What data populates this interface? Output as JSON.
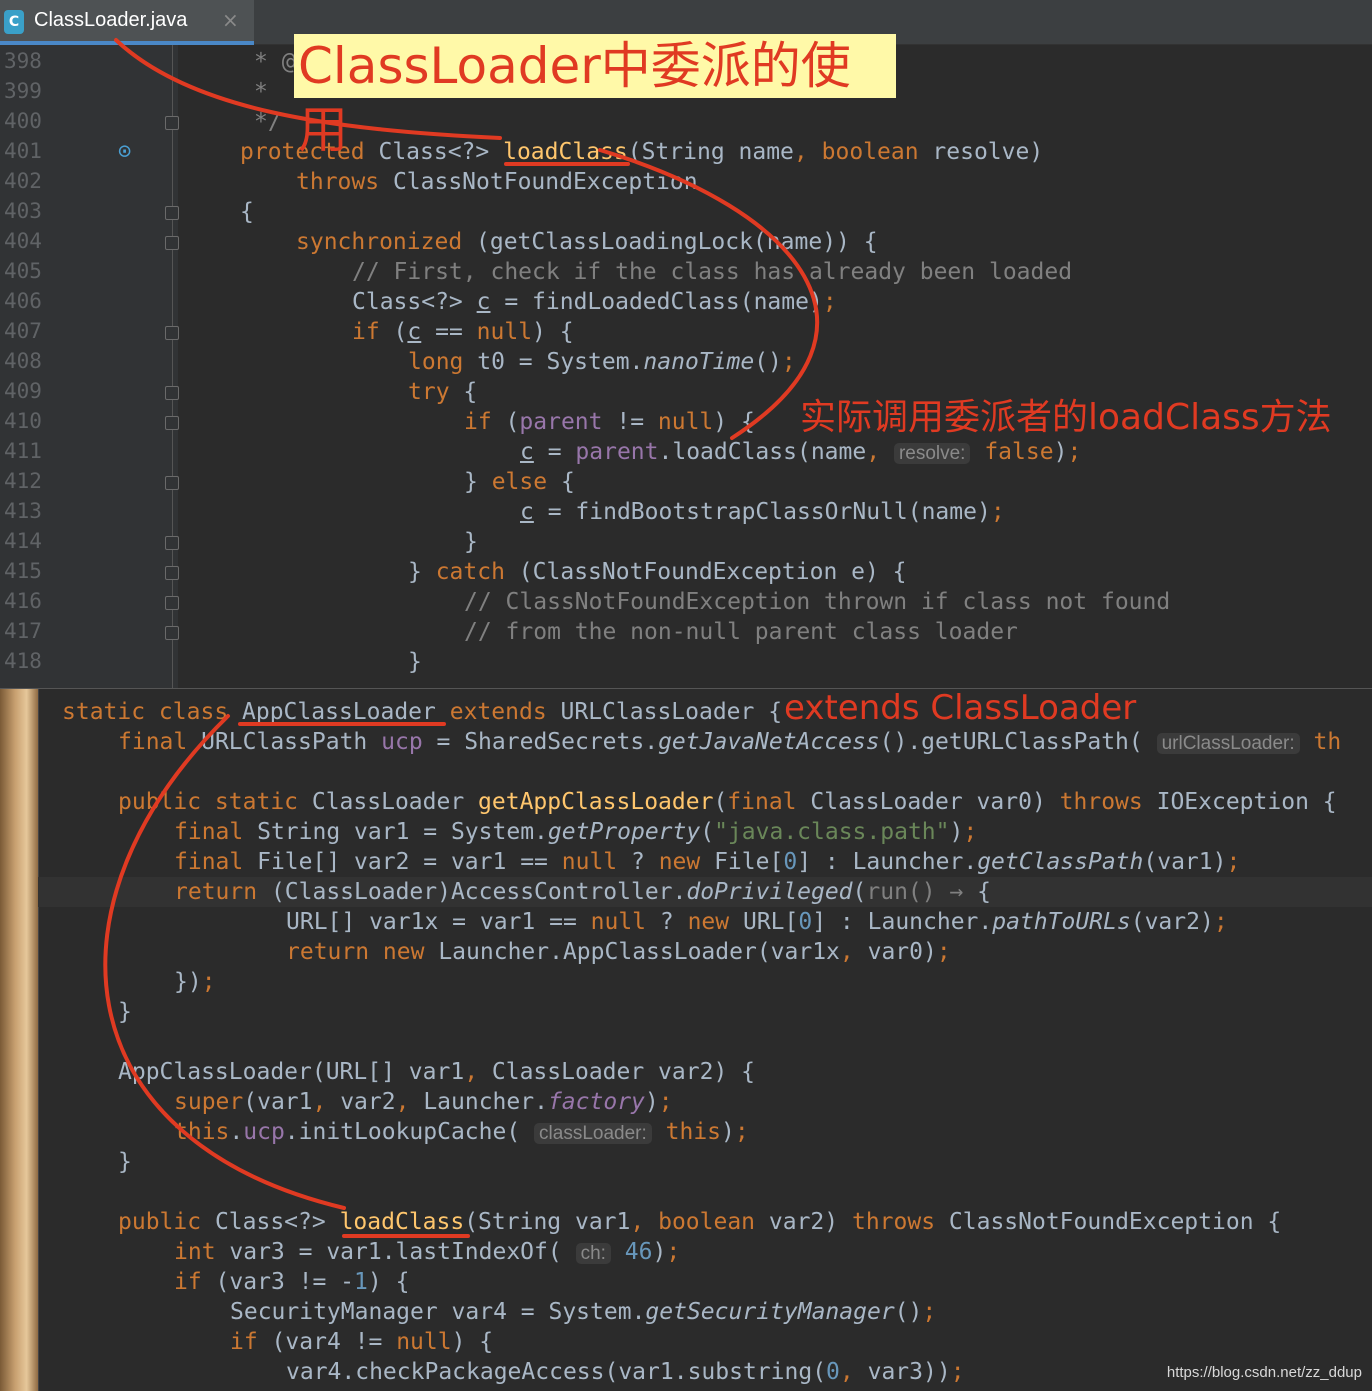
{
  "tab": {
    "label": "ClassLoader.java",
    "icon": "class-file-icon",
    "close": "×"
  },
  "top_editor": {
    "line_numbers": [
      "398",
      "399",
      "400",
      "401",
      "402",
      "403",
      "404",
      "405",
      "406",
      "407",
      "408",
      "409",
      "410",
      "411",
      "412",
      "413",
      "414",
      "415",
      "416",
      "417",
      "418"
    ],
    "lines": [
      "* @",
      "*",
      "*/",
      "protected Class<?> loadClass(String name, boolean resolve)",
      "throws ClassNotFoundException",
      "{",
      "synchronized (getClassLoadingLock(name)) {",
      "// First, check if the class has already been loaded",
      "Class<?> c = findLoadedClass(name);",
      "if (c == null) {",
      "long t0 = System.nanoTime();",
      "try {",
      "if (parent != null) {",
      "c = parent.loadClass(name, resolve: false);",
      "} else {",
      "c = findBootstrapClassOrNull(name);",
      "}",
      "} catch (ClassNotFoundException e) {",
      "// ClassNotFoundException thrown if class not found",
      "// from the non-null parent class loader",
      "}"
    ]
  },
  "bottom_editor": {
    "lines": [
      "static class AppClassLoader extends URLClassLoader {",
      "final URLClassPath ucp = SharedSecrets.getJavaNetAccess().getURLClassPath( urlClassLoader: th",
      "",
      "public static ClassLoader getAppClassLoader(final ClassLoader var0) throws IOException {",
      "final String var1 = System.getProperty(\"java.class.path\");",
      "final File[] var2 = var1 == null ? new File[0] : Launcher.getClassPath(var1);",
      "return (ClassLoader)AccessController.doPrivileged(run() → {",
      "URL[] var1x = var1 == null ? new URL[0] : Launcher.pathToURLs(var2);",
      "return new Launcher.AppClassLoader(var1x, var0);",
      "});",
      "}",
      "",
      "AppClassLoader(URL[] var1, ClassLoader var2) {",
      "super(var1, var2, Launcher.factory);",
      "this.ucp.initLookupCache( classLoader: this);",
      "}",
      "",
      "public Class<?> loadClass(String var1, boolean var2) throws ClassNotFoundException {",
      "int var3 = var1.lastIndexOf( ch: 46);",
      "if (var3 != -1) {",
      "SecurityManager var4 = System.getSecurityManager();",
      "if (var4 != null) {",
      "var4.checkPackageAccess(var1.substring(0, var3));"
    ]
  },
  "hints": {
    "resolve": "resolve:",
    "url_class_loader": "urlClassLoader:",
    "class_loader": "classLoader:",
    "ch": "ch:"
  },
  "annotations": {
    "title": "ClassLoader中委派的使用",
    "parent_call": "实际调用委派者的loadClass方法",
    "extends": "extends ClassLoader"
  },
  "watermark": "https://blog.csdn.net/zz_ddup",
  "colors": {
    "background": "#2b2b2b",
    "keyword": "#cc7832",
    "method": "#ffc66d",
    "field": "#9876aa",
    "comment": "#808080",
    "string": "#6a8759",
    "number": "#6897bb",
    "annotation": "#e03a22",
    "title_bg": "#fff9a8"
  }
}
